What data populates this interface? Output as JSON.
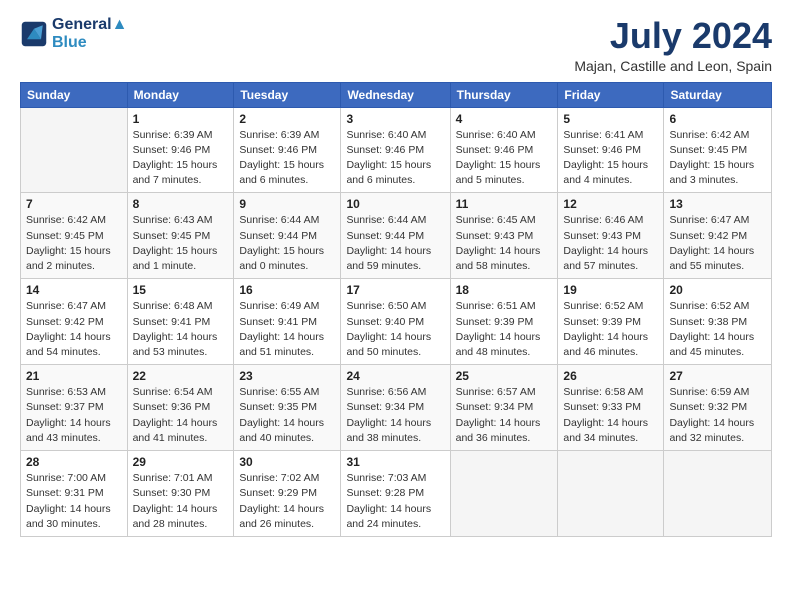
{
  "header": {
    "logo_line1": "General",
    "logo_line2": "Blue",
    "month_year": "July 2024",
    "location": "Majan, Castille and Leon, Spain"
  },
  "weekdays": [
    "Sunday",
    "Monday",
    "Tuesday",
    "Wednesday",
    "Thursday",
    "Friday",
    "Saturday"
  ],
  "weeks": [
    [
      {
        "day": "",
        "sunrise": "",
        "sunset": "",
        "daylight": ""
      },
      {
        "day": "1",
        "sunrise": "Sunrise: 6:39 AM",
        "sunset": "Sunset: 9:46 PM",
        "daylight": "Daylight: 15 hours and 7 minutes."
      },
      {
        "day": "2",
        "sunrise": "Sunrise: 6:39 AM",
        "sunset": "Sunset: 9:46 PM",
        "daylight": "Daylight: 15 hours and 6 minutes."
      },
      {
        "day": "3",
        "sunrise": "Sunrise: 6:40 AM",
        "sunset": "Sunset: 9:46 PM",
        "daylight": "Daylight: 15 hours and 6 minutes."
      },
      {
        "day": "4",
        "sunrise": "Sunrise: 6:40 AM",
        "sunset": "Sunset: 9:46 PM",
        "daylight": "Daylight: 15 hours and 5 minutes."
      },
      {
        "day": "5",
        "sunrise": "Sunrise: 6:41 AM",
        "sunset": "Sunset: 9:46 PM",
        "daylight": "Daylight: 15 hours and 4 minutes."
      },
      {
        "day": "6",
        "sunrise": "Sunrise: 6:42 AM",
        "sunset": "Sunset: 9:45 PM",
        "daylight": "Daylight: 15 hours and 3 minutes."
      }
    ],
    [
      {
        "day": "7",
        "sunrise": "Sunrise: 6:42 AM",
        "sunset": "Sunset: 9:45 PM",
        "daylight": "Daylight: 15 hours and 2 minutes."
      },
      {
        "day": "8",
        "sunrise": "Sunrise: 6:43 AM",
        "sunset": "Sunset: 9:45 PM",
        "daylight": "Daylight: 15 hours and 1 minute."
      },
      {
        "day": "9",
        "sunrise": "Sunrise: 6:44 AM",
        "sunset": "Sunset: 9:44 PM",
        "daylight": "Daylight: 15 hours and 0 minutes."
      },
      {
        "day": "10",
        "sunrise": "Sunrise: 6:44 AM",
        "sunset": "Sunset: 9:44 PM",
        "daylight": "Daylight: 14 hours and 59 minutes."
      },
      {
        "day": "11",
        "sunrise": "Sunrise: 6:45 AM",
        "sunset": "Sunset: 9:43 PM",
        "daylight": "Daylight: 14 hours and 58 minutes."
      },
      {
        "day": "12",
        "sunrise": "Sunrise: 6:46 AM",
        "sunset": "Sunset: 9:43 PM",
        "daylight": "Daylight: 14 hours and 57 minutes."
      },
      {
        "day": "13",
        "sunrise": "Sunrise: 6:47 AM",
        "sunset": "Sunset: 9:42 PM",
        "daylight": "Daylight: 14 hours and 55 minutes."
      }
    ],
    [
      {
        "day": "14",
        "sunrise": "Sunrise: 6:47 AM",
        "sunset": "Sunset: 9:42 PM",
        "daylight": "Daylight: 14 hours and 54 minutes."
      },
      {
        "day": "15",
        "sunrise": "Sunrise: 6:48 AM",
        "sunset": "Sunset: 9:41 PM",
        "daylight": "Daylight: 14 hours and 53 minutes."
      },
      {
        "day": "16",
        "sunrise": "Sunrise: 6:49 AM",
        "sunset": "Sunset: 9:41 PM",
        "daylight": "Daylight: 14 hours and 51 minutes."
      },
      {
        "day": "17",
        "sunrise": "Sunrise: 6:50 AM",
        "sunset": "Sunset: 9:40 PM",
        "daylight": "Daylight: 14 hours and 50 minutes."
      },
      {
        "day": "18",
        "sunrise": "Sunrise: 6:51 AM",
        "sunset": "Sunset: 9:39 PM",
        "daylight": "Daylight: 14 hours and 48 minutes."
      },
      {
        "day": "19",
        "sunrise": "Sunrise: 6:52 AM",
        "sunset": "Sunset: 9:39 PM",
        "daylight": "Daylight: 14 hours and 46 minutes."
      },
      {
        "day": "20",
        "sunrise": "Sunrise: 6:52 AM",
        "sunset": "Sunset: 9:38 PM",
        "daylight": "Daylight: 14 hours and 45 minutes."
      }
    ],
    [
      {
        "day": "21",
        "sunrise": "Sunrise: 6:53 AM",
        "sunset": "Sunset: 9:37 PM",
        "daylight": "Daylight: 14 hours and 43 minutes."
      },
      {
        "day": "22",
        "sunrise": "Sunrise: 6:54 AM",
        "sunset": "Sunset: 9:36 PM",
        "daylight": "Daylight: 14 hours and 41 minutes."
      },
      {
        "day": "23",
        "sunrise": "Sunrise: 6:55 AM",
        "sunset": "Sunset: 9:35 PM",
        "daylight": "Daylight: 14 hours and 40 minutes."
      },
      {
        "day": "24",
        "sunrise": "Sunrise: 6:56 AM",
        "sunset": "Sunset: 9:34 PM",
        "daylight": "Daylight: 14 hours and 38 minutes."
      },
      {
        "day": "25",
        "sunrise": "Sunrise: 6:57 AM",
        "sunset": "Sunset: 9:34 PM",
        "daylight": "Daylight: 14 hours and 36 minutes."
      },
      {
        "day": "26",
        "sunrise": "Sunrise: 6:58 AM",
        "sunset": "Sunset: 9:33 PM",
        "daylight": "Daylight: 14 hours and 34 minutes."
      },
      {
        "day": "27",
        "sunrise": "Sunrise: 6:59 AM",
        "sunset": "Sunset: 9:32 PM",
        "daylight": "Daylight: 14 hours and 32 minutes."
      }
    ],
    [
      {
        "day": "28",
        "sunrise": "Sunrise: 7:00 AM",
        "sunset": "Sunset: 9:31 PM",
        "daylight": "Daylight: 14 hours and 30 minutes."
      },
      {
        "day": "29",
        "sunrise": "Sunrise: 7:01 AM",
        "sunset": "Sunset: 9:30 PM",
        "daylight": "Daylight: 14 hours and 28 minutes."
      },
      {
        "day": "30",
        "sunrise": "Sunrise: 7:02 AM",
        "sunset": "Sunset: 9:29 PM",
        "daylight": "Daylight: 14 hours and 26 minutes."
      },
      {
        "day": "31",
        "sunrise": "Sunrise: 7:03 AM",
        "sunset": "Sunset: 9:28 PM",
        "daylight": "Daylight: 14 hours and 24 minutes."
      },
      {
        "day": "",
        "sunrise": "",
        "sunset": "",
        "daylight": ""
      },
      {
        "day": "",
        "sunrise": "",
        "sunset": "",
        "daylight": ""
      },
      {
        "day": "",
        "sunrise": "",
        "sunset": "",
        "daylight": ""
      }
    ]
  ]
}
